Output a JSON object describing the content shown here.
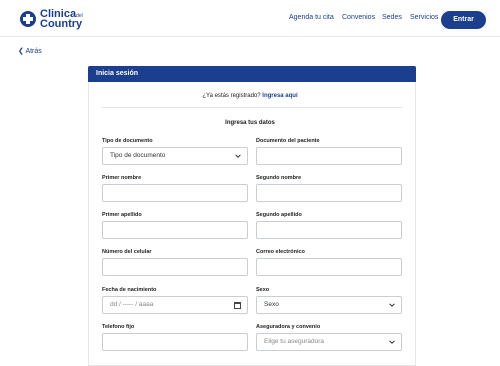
{
  "header": {
    "logo_line1": "Clinica",
    "logo_small": "del",
    "logo_line2": "Country",
    "nav": [
      "Agenda tu cita",
      "Convenios",
      "Sedes",
      "Servicios"
    ],
    "entrar_label": "Entrar"
  },
  "back_label": "Atrás",
  "card": {
    "title": "Inicia sesión",
    "already_text": "¿Ya estás registrado?",
    "already_link": "Ingresa aquí",
    "subtitle": "Ingresa tus datos"
  },
  "form": {
    "tipo_documento_label": "Tipo de documento",
    "tipo_documento_value": "Tipo de documento",
    "documento_paciente_label": "Documento del paciente",
    "primer_nombre_label": "Primer nombre",
    "segundo_nombre_label": "Segundo nombre",
    "primer_apellido_label": "Primer apellido",
    "segundo_apellido_label": "Segundo apellido",
    "celular_label": "Número del celular",
    "correo_label": "Correo electrónico",
    "fecha_label": "Fecha de nacimiento",
    "fecha_placeholder": "dd / ----- / aaaa",
    "sexo_label": "Sexo",
    "sexo_value": "Sexo",
    "telefono_label": "Telefono fijo",
    "aseguradora_label": "Aseguradora y convenio",
    "aseguradora_placeholder": "Elige tu aseguradora"
  },
  "colors": {
    "brand": "#1b3f8e"
  }
}
